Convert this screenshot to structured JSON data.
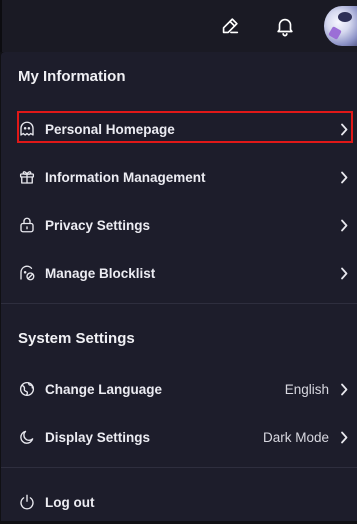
{
  "header": {
    "icons": [
      "edit-icon",
      "bell-icon",
      "avatar"
    ]
  },
  "my_information": {
    "title": "My Information",
    "items": [
      {
        "label": "Personal Homepage",
        "icon": "profile-ghost-icon"
      },
      {
        "label": "Information Management",
        "icon": "gift-icon"
      },
      {
        "label": "Privacy Settings",
        "icon": "lock-icon"
      },
      {
        "label": "Manage Blocklist",
        "icon": "blocked-user-icon"
      }
    ]
  },
  "system_settings": {
    "title": "System Settings",
    "items": [
      {
        "label": "Change Language",
        "value": "English",
        "icon": "globe-icon"
      },
      {
        "label": "Display Settings",
        "value": "Dark Mode",
        "icon": "moon-icon"
      }
    ]
  },
  "logout": {
    "label": "Log out",
    "icon": "power-icon"
  },
  "colors": {
    "panel_bg": "#1d1d2b",
    "highlight_border": "#e01818",
    "text": "#ececf2"
  }
}
